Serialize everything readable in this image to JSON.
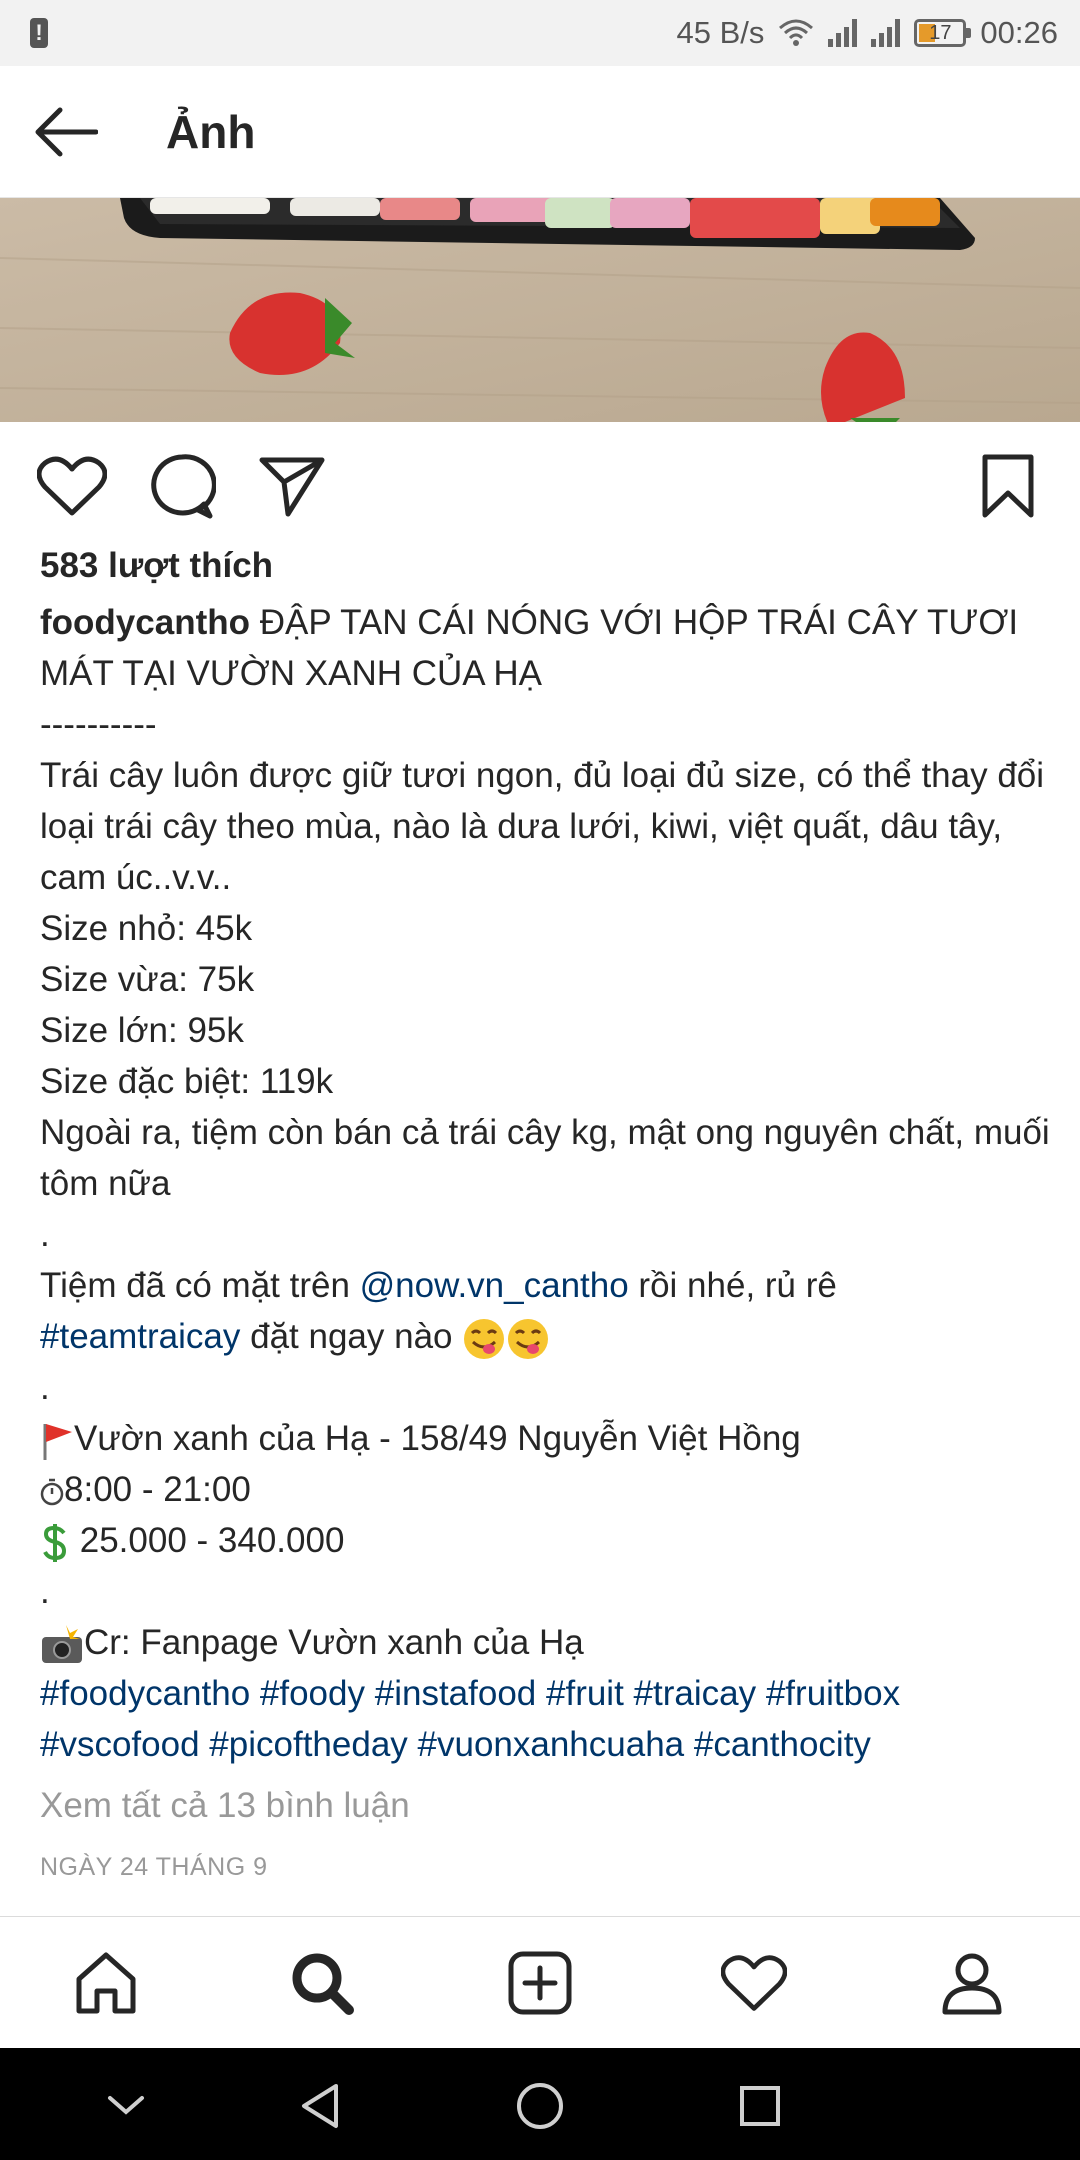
{
  "status_bar": {
    "net_speed": "45 B/s",
    "battery": "17",
    "time": "00:26"
  },
  "header": {
    "title": "Ảnh"
  },
  "post": {
    "likes": "583 lượt thích",
    "username": "foodycantho",
    "headline": "ĐẬP TAN CÁI NÓNG VỚI HỘP TRÁI CÂY TƯƠI MÁT TẠI VƯỜN XANH CỦA HẠ",
    "separator": "----------",
    "description": "Trái cây luôn được giữ tươi ngon, đủ loại đủ size, có thể thay đổi loại trái cây theo mùa, nào là dưa lưới, kiwi, việt quất, dâu tây, cam úc..v.v..",
    "size_small": "Size nhỏ: 45k",
    "size_medium": "Size vừa: 75k",
    "size_large": "Size lớn: 95k",
    "size_special": "Size đặc biệt: 119k",
    "extra": "Ngoài ra, tiệm còn bán cả trái cây kg, mật ong nguyên chất, muối tôm nữa",
    "dot": ".",
    "now_prefix": "Tiệm đã có mặt trên ",
    "now_mention": "@now.vn_cantho",
    "now_suffix": " rồi nhé, rủ rê",
    "team_tag": "#teamtraicay",
    "team_suffix": " đặt ngay nào ",
    "address": "Vườn xanh của Hạ - 158/49 Nguyễn Việt Hồng",
    "hours": "8:00 - 21:00",
    "price": "25.000 - 340.000",
    "credit": "Cr: Fanpage Vườn xanh của Hạ",
    "hashtags_line1": [
      "#foodycantho",
      "#foody",
      "#instafood",
      "#fruit",
      "#traicay",
      "#fruitbox"
    ],
    "hashtags_line2": [
      "#vscofood",
      "#picoftheday",
      "#vuonxanhcuaha",
      "#canthocity"
    ],
    "view_comments": "Xem tất cả 13 bình luận",
    "date": "NGÀY 24 THÁNG 9"
  },
  "icons": {
    "back": "arrow-left-icon",
    "like": "heart-icon",
    "comment": "comment-icon",
    "share": "send-icon",
    "save": "bookmark-icon",
    "nav": [
      "home-icon",
      "search-icon",
      "add-icon",
      "heart-icon",
      "profile-icon"
    ]
  },
  "colors": {
    "link": "#003569",
    "muted": "#999999",
    "text": "#262626"
  }
}
